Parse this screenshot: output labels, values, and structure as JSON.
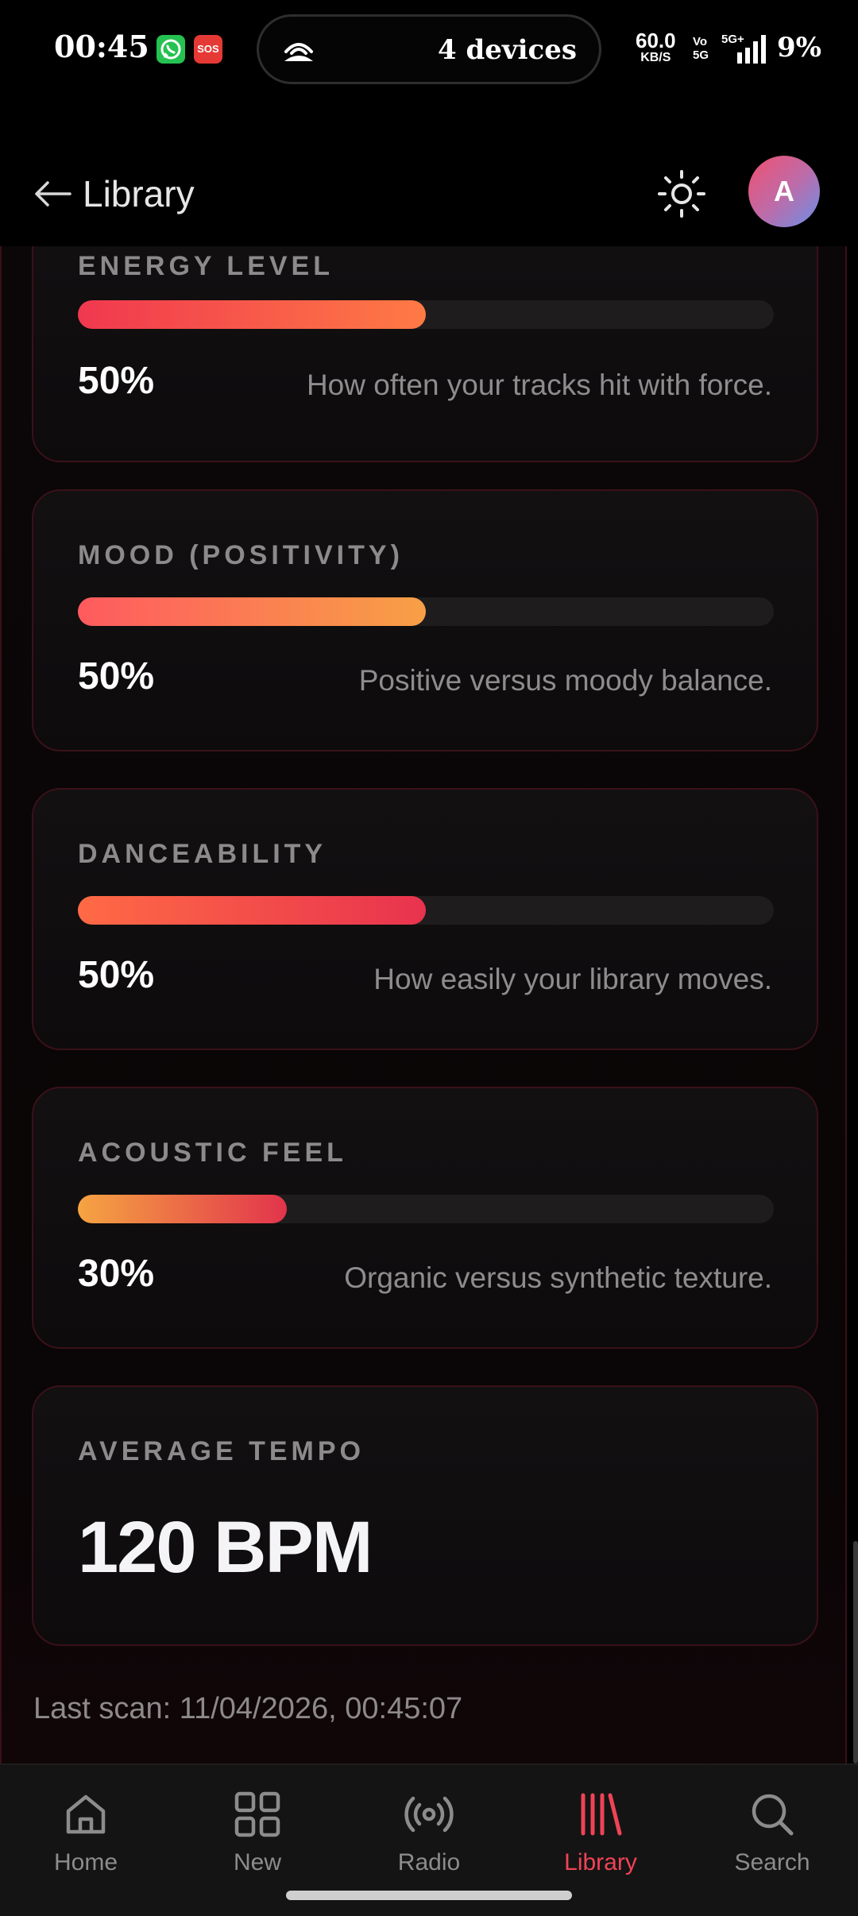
{
  "status_bar": {
    "time": "00:45",
    "whatsapp_icon": "whatsapp-icon",
    "sos_label": "SOS",
    "hotspot_icon": "hotspot-icon",
    "devices": "4 devices",
    "speed_value": "60.0",
    "speed_unit": "KB/S",
    "volte_top": "Vo",
    "volte_bottom": "5G",
    "signal_label": "5G+",
    "battery": "9%"
  },
  "header": {
    "back_icon": "arrow-left-icon",
    "title": "Library",
    "theme_icon": "sun-icon",
    "avatar_initial": "A",
    "avatar_colors": [
      "#f0506e",
      "#c06aa6",
      "#6a90e8"
    ]
  },
  "metrics": [
    {
      "label": "ENERGY LEVEL",
      "percent_text": "50%",
      "value": 0.5,
      "description": "How often your tracks hit with force.",
      "gradient": [
        "#f0384f",
        "#ff7a45"
      ]
    },
    {
      "label": "MOOD (POSITIVITY)",
      "percent_text": "50%",
      "value": 0.5,
      "description": "Positive versus moody balance.",
      "gradient": [
        "#ff5a5f",
        "#f7a046"
      ]
    },
    {
      "label": "DANCEABILITY",
      "percent_text": "50%",
      "value": 0.5,
      "description": "How easily your library moves.",
      "gradient": [
        "#ff6a45",
        "#e8334e"
      ]
    },
    {
      "label": "ACOUSTIC FEEL",
      "percent_text": "30%",
      "value": 0.3,
      "description": "Organic versus synthetic texture.",
      "gradient": [
        "#f5a442",
        "#e2344c"
      ]
    }
  ],
  "tempo": {
    "label": "AVERAGE TEMPO",
    "value": "120 BPM"
  },
  "last_scan": "Last scan: 11/04/2026, 00:45:07",
  "bottom_nav": [
    {
      "label": "Home",
      "icon": "home-icon",
      "active": false
    },
    {
      "label": "New",
      "icon": "grid-icon",
      "active": false
    },
    {
      "label": "Radio",
      "icon": "radio-icon",
      "active": false
    },
    {
      "label": "Library",
      "icon": "library-icon",
      "active": true
    },
    {
      "label": "Search",
      "icon": "search-icon",
      "active": false
    }
  ],
  "colors": {
    "accent": "#f04356",
    "background": "#000000",
    "card_border": "#3a1119"
  }
}
